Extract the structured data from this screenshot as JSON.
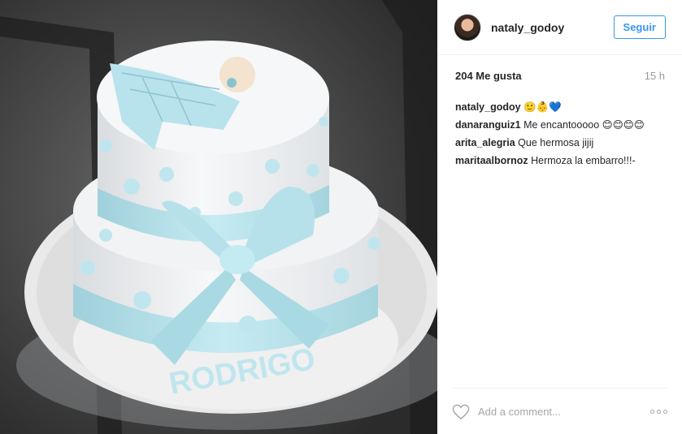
{
  "post": {
    "photo_text": "RODRIGO"
  },
  "header": {
    "username": "nataly_godoy",
    "follow_label": "Seguir"
  },
  "stats": {
    "likes": "204 Me gusta",
    "time": "15 h"
  },
  "comments": [
    {
      "user": "nataly_godoy",
      "text": "🙂👶💙"
    },
    {
      "user": "danaranguiz1",
      "text": "Me encantooooo 😊😊😊😊"
    },
    {
      "user": "arita_alegria",
      "text": "Que hermosa jijij"
    },
    {
      "user": "maritaalbornoz",
      "text": "Hermoza la embarro!!!-"
    }
  ],
  "footer": {
    "comment_placeholder": "Add a comment..."
  },
  "colors": {
    "accent": "#3897f0",
    "cake_blue": "#bfe6ee",
    "cake_white": "#f4f5f6"
  }
}
